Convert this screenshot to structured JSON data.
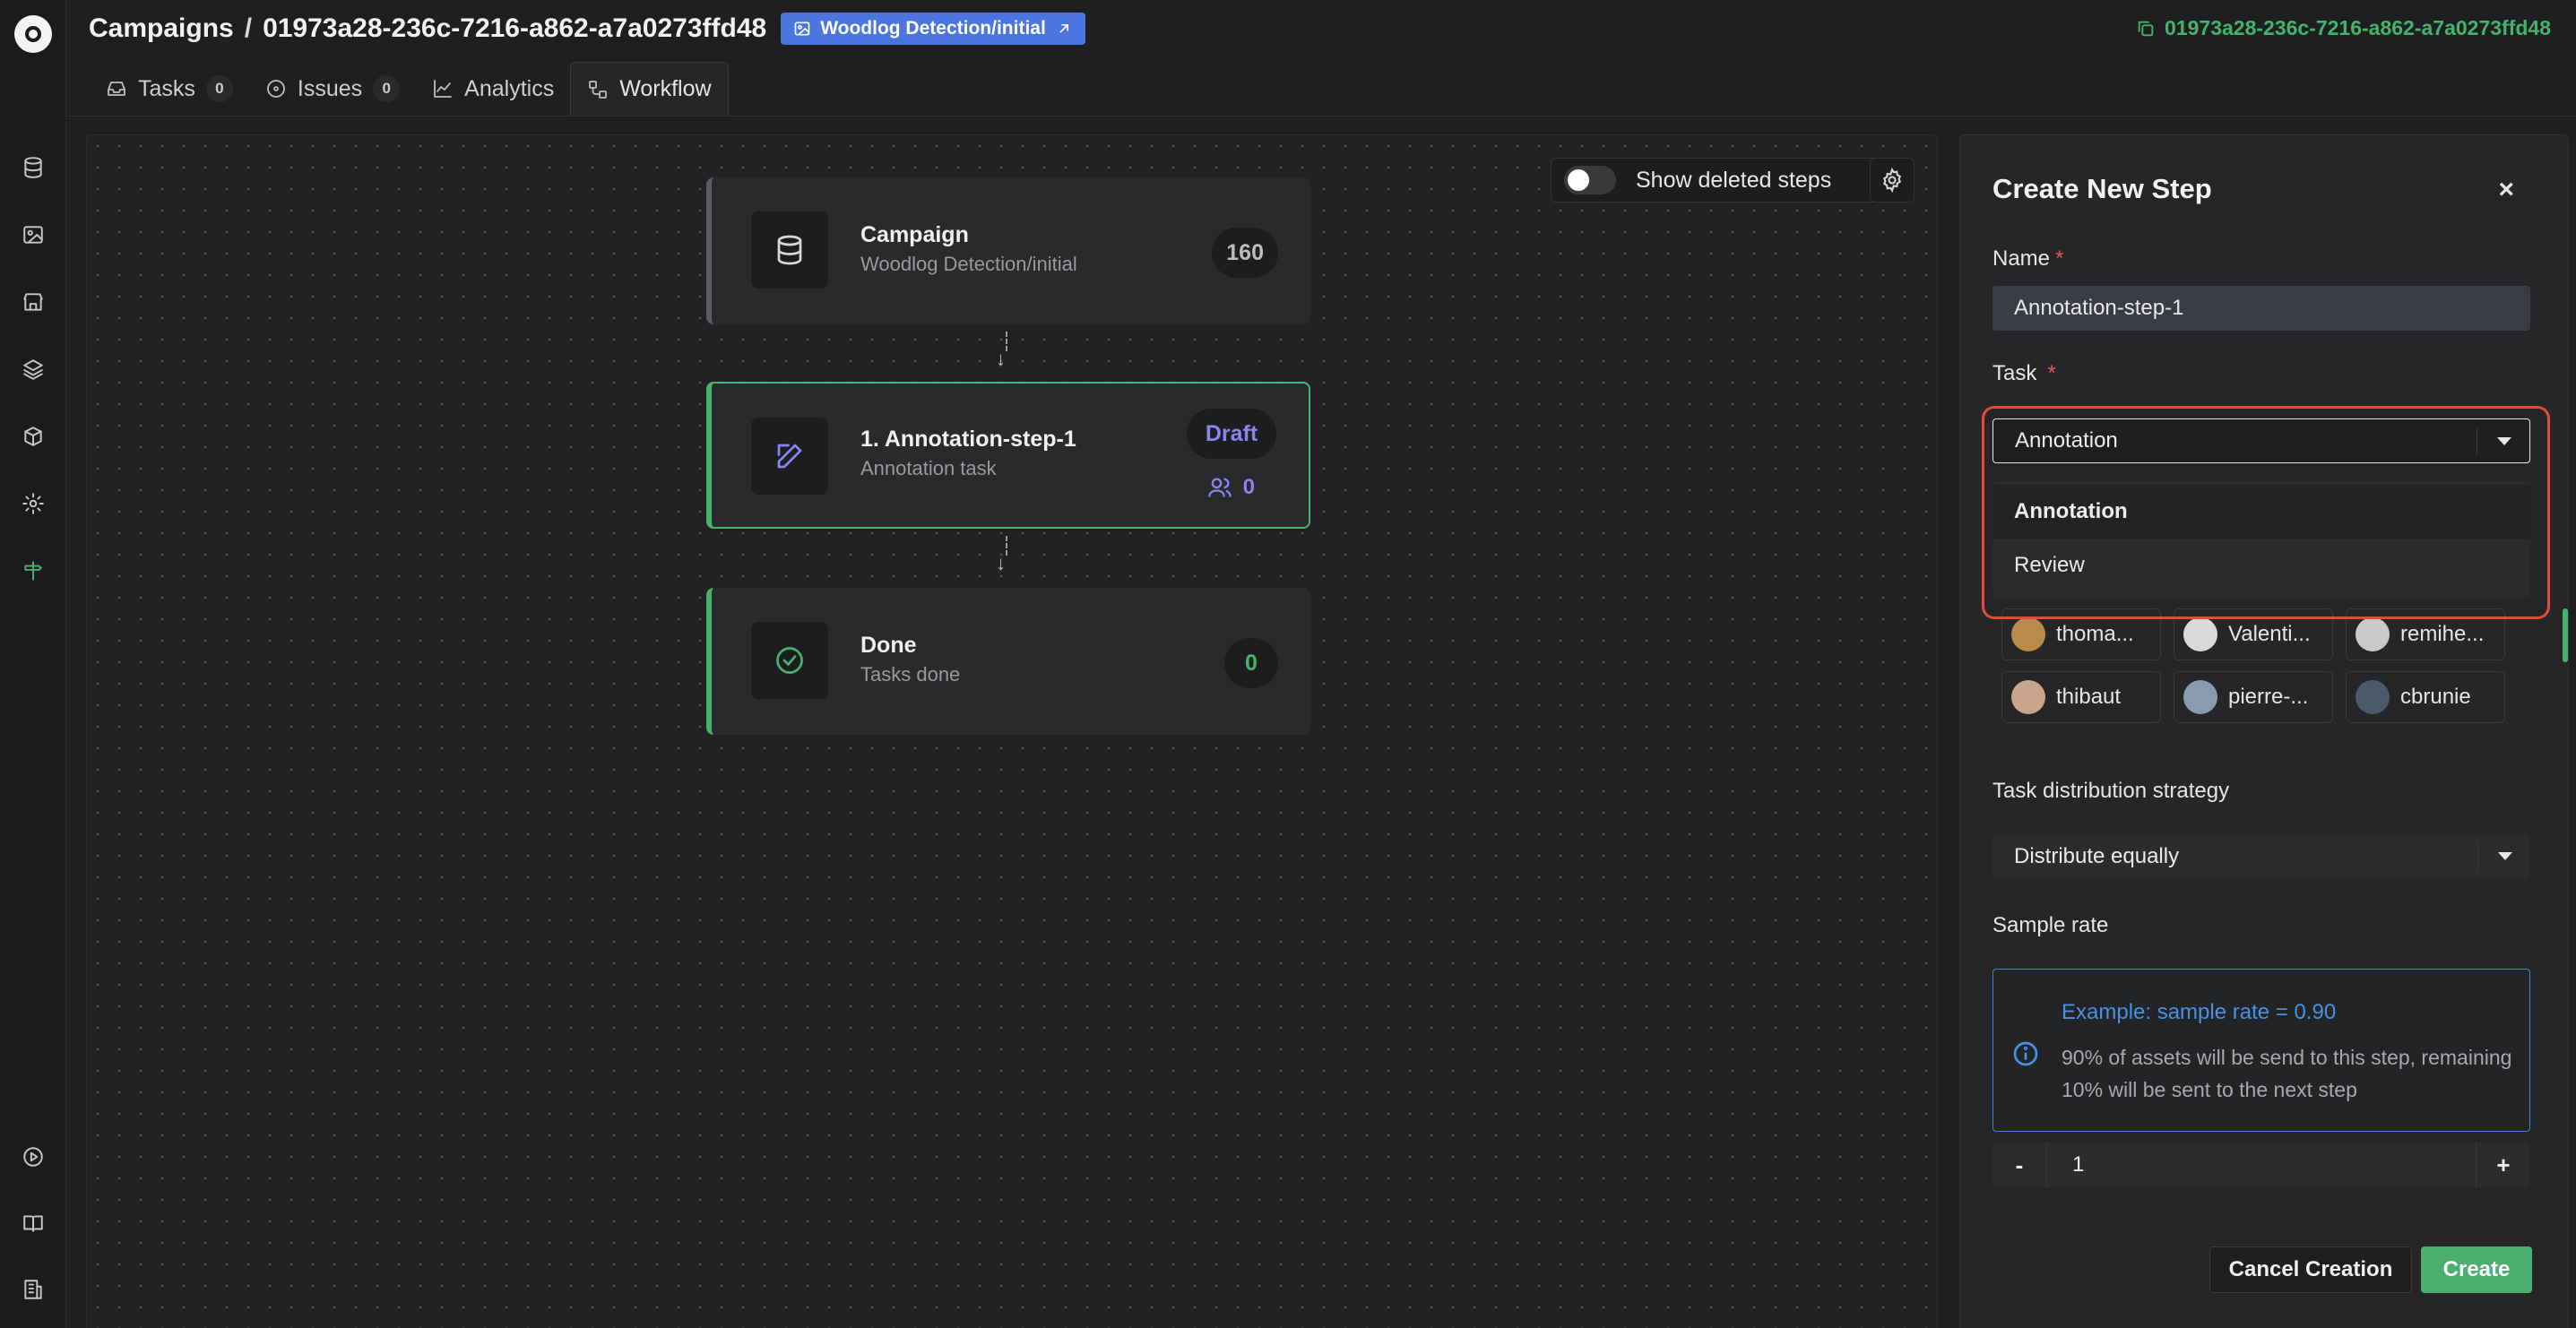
{
  "breadcrumb": {
    "root": "Campaigns",
    "separator": "/",
    "campaign_id": "01973a28-236c-7216-a862-a7a0273ffd48",
    "dataset_chip": "Woodlog Detection/initial"
  },
  "header": {
    "copy_id": "01973a28-236c-7216-a862-a7a0273ffd48"
  },
  "tabs": [
    {
      "label": "Tasks",
      "count": "0",
      "icon": "inbox-icon"
    },
    {
      "label": "Issues",
      "count": "0",
      "icon": "alert-circle-icon"
    },
    {
      "label": "Analytics",
      "icon": "chart-line-icon"
    },
    {
      "label": "Workflow",
      "icon": "workflow-icon",
      "active": true
    }
  ],
  "canvas": {
    "show_deleted_label": "Show deleted steps",
    "show_deleted_on": false,
    "nodes": {
      "campaign": {
        "title": "Campaign",
        "subtitle": "Woodlog Detection/initial",
        "count": "160"
      },
      "annotation": {
        "title": "1. Annotation-step-1",
        "subtitle": "Annotation task",
        "status": "Draft",
        "users": "0"
      },
      "done": {
        "title": "Done",
        "subtitle": "Tasks done",
        "count": "0"
      }
    }
  },
  "panel": {
    "title": "Create New Step",
    "close": "×",
    "name_label": "Name",
    "required_mark": "*",
    "name_value": "Annotation-step-1",
    "task_label": "Task",
    "task_value": "Annotation",
    "task_options": [
      "Annotation",
      "Review"
    ],
    "assignees": [
      {
        "name": "thoma...",
        "avatar_color": "#b98a4a"
      },
      {
        "name": "Valenti...",
        "avatar_color": "#d9d9d9"
      },
      {
        "name": "remihe...",
        "avatar_color": "#c9c9c9"
      },
      {
        "name": "thibaut",
        "avatar_color": "#c8a58c"
      },
      {
        "name": "pierre-...",
        "avatar_color": "#8a9bb0"
      },
      {
        "name": "cbrunie",
        "avatar_color": "#4a5a6a"
      }
    ],
    "distribution_label": "Task distribution strategy",
    "distribution_value": "Distribute equally",
    "sample_rate_label": "Sample rate",
    "info_example": "Example: sample rate = 0.90",
    "info_description": "90% of assets will be send to this step, remaining 10% will be sent to the next step",
    "stepper": {
      "minus": "-",
      "value": "1",
      "plus": "+"
    },
    "cancel_label": "Cancel Creation",
    "create_label": "Create"
  },
  "colors": {
    "accent_green": "#45b36b",
    "chip_blue": "#4a74e0",
    "draft_purple": "#8b84f0",
    "highlight_red": "#e24a3a",
    "info_blue": "#4a90e2"
  }
}
